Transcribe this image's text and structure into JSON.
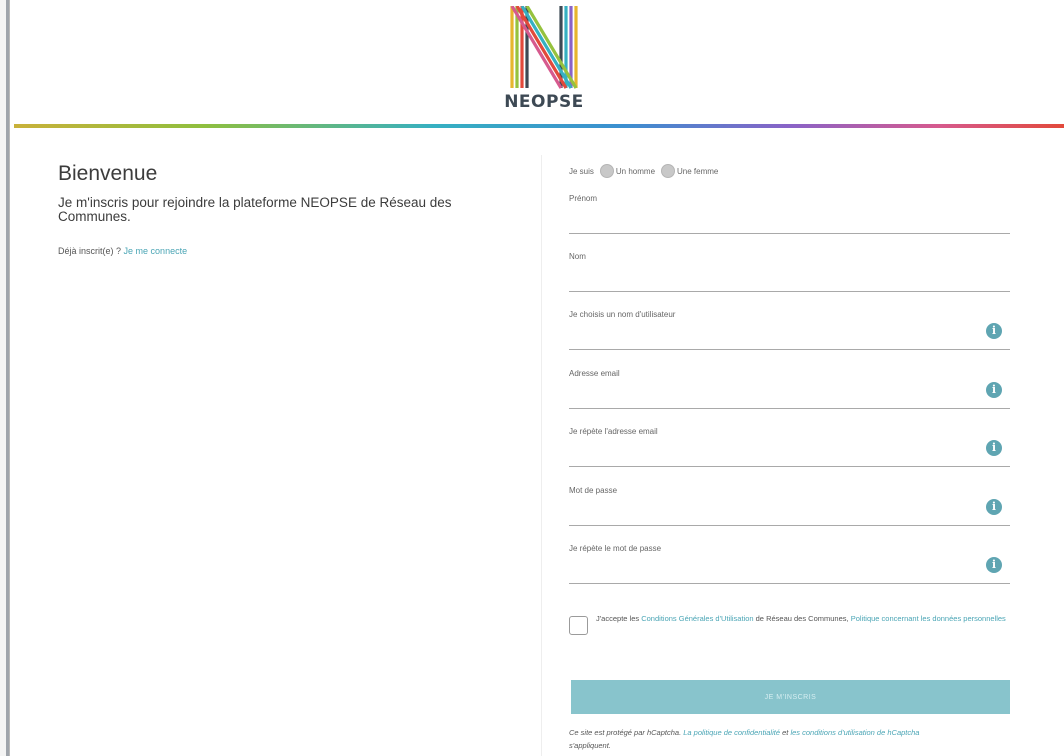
{
  "brand": {
    "name": "NEOPSE"
  },
  "welcome": {
    "title": "Bienvenue",
    "intro": "Je m'inscris pour rejoindre la plateforme NEOPSE de Réseau des Communes.",
    "already_text": "Déjà inscrit(e) ?",
    "login_link": "Je me connecte"
  },
  "form": {
    "gender": {
      "label": "Je suis",
      "male": "Un homme",
      "female": "Une femme"
    },
    "fields": [
      {
        "label": "Prénom",
        "value": ""
      },
      {
        "label": "Nom",
        "value": ""
      },
      {
        "label": "Je choisis un nom d'utilisateur",
        "value": ""
      },
      {
        "label": "Adresse email",
        "value": ""
      },
      {
        "label": "Je répète l'adresse email",
        "value": ""
      },
      {
        "label": "Mot de passe",
        "value": ""
      },
      {
        "label": "Je répète le mot de passe",
        "value": ""
      }
    ],
    "accept": {
      "prefix": "J'accepte les",
      "cgu_link": "Conditions Générales d'Utilisation",
      "middle": "de Réseau des Communes,",
      "policy_link": "Politique concernant les données personnelles"
    },
    "submit_label": "Je m'inscris",
    "captcha": {
      "prefix": "Ce site est protégé par hCaptcha.",
      "privacy_link": "La politique de confidentialité",
      "and": "et",
      "terms_link": "les conditions d'utilisation de hCaptcha",
      "suffix": "s'appliquent."
    }
  },
  "icons": {
    "field_help": "info-icon"
  },
  "colors": {
    "accent": "#4aa5b5",
    "button": "#88c4cc",
    "info": "#5fa5b2"
  }
}
